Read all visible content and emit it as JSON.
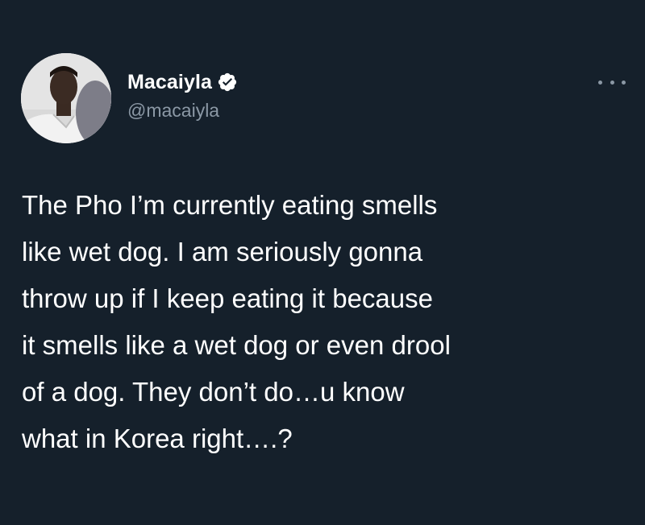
{
  "theme": {
    "background": "#15202b",
    "text_primary": "#ffffff",
    "text_secondary": "#8b98a5",
    "verified_badge": "#ffffff"
  },
  "author": {
    "display_name": "Macaiyla",
    "handle": "@macaiyla",
    "verified": true,
    "verified_icon": "verified-badge-icon",
    "avatar": "profile-photo"
  },
  "actions": {
    "more_icon": "more-options-icon"
  },
  "tweet": {
    "text": "The Pho I’m currently eating smells\nlike wet dog. I am seriously gonna\nthrow up if I keep eating it because\nit smells like a wet dog or even drool\nof a dog. They don’t do…u know\nwhat in Korea right….?"
  }
}
